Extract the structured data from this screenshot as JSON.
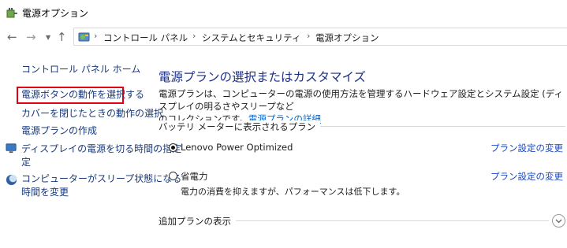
{
  "window": {
    "title": "電源オプション"
  },
  "breadcrumb": [
    "コントロール パネル",
    "システムとセキュリティ",
    "電源オプション"
  ],
  "sidebar": {
    "home": "コントロール パネル ホーム",
    "items": [
      "電源ボタンの動作を選択する",
      "カバーを閉じたときの動作の選択",
      "電源プランの作成",
      "ディスプレイの電源を切る時間の指定",
      "定",
      "コンピューターがスリープ状態になる",
      "時間を変更"
    ]
  },
  "main": {
    "heading": "電源プランの選択またはカスタマイズ",
    "desc_line1": "電源プランは、コンピューターの電源の使用方法を管理するハードウェア設定とシステム設定 (ディスプレイの明るさやスリープなど",
    "desc_line2": "のコレクションです。",
    "desc_link": "電源プランの詳細",
    "group_label": "バッテリ メーターに表示されるプラン",
    "plans": [
      {
        "name": "Lenovo Power Optimized",
        "link": "プラン設定の変更",
        "selected": true
      },
      {
        "name": "省電力",
        "link": "プラン設定の変更",
        "desc": "電力の消費を抑えますが、パフォーマンスは低下します。",
        "selected": false
      }
    ],
    "more_plans": "追加プランの表示"
  },
  "colors": {
    "highlight": "#e10014",
    "link": "#1a49c5",
    "heading": "#1e3287"
  }
}
